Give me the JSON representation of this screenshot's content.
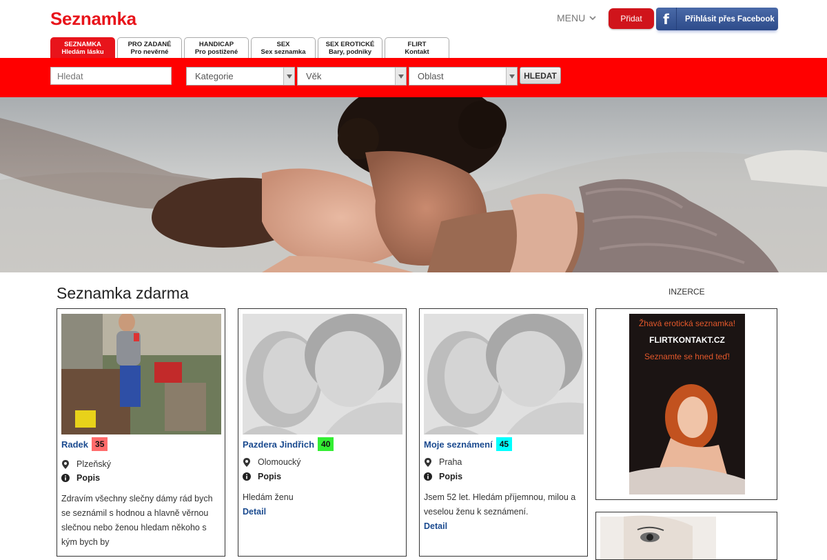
{
  "header": {
    "logo": "Seznamka",
    "menu_label": "MENU",
    "add_label": "Přidat",
    "facebook_label": "Přihlásit přes Facebook"
  },
  "tabs": [
    {
      "title": "SEZNAMKA",
      "sub": "Hledám lásku",
      "active": true
    },
    {
      "title": "PRO ZADANÉ",
      "sub": "Pro nevěrné",
      "active": false
    },
    {
      "title": "HANDICAP",
      "sub": "Pro postižené",
      "active": false
    },
    {
      "title": "SEX",
      "sub": "Sex seznamka",
      "active": false
    },
    {
      "title": "SEX EROTICKÉ",
      "sub": "Bary, podniky",
      "active": false
    },
    {
      "title": "FLIRT",
      "sub": "Kontakt",
      "active": false
    }
  ],
  "search": {
    "placeholder": "Hledat",
    "category": "Kategorie",
    "age": "Věk",
    "region": "Oblast",
    "button": "HLEDAT"
  },
  "content": {
    "title": "Seznamka zdarma",
    "ads_label": "INZERCE"
  },
  "cards": [
    {
      "name": "Radek",
      "age": "35",
      "age_color": "#ff6b6b",
      "location": "Plzeňský",
      "popis_label": "Popis",
      "description": "Zdravím všechny slečny dámy rád bych se seznámil s hodnou a hlavně věrnou slečnou nebo ženou hledam někoho s kým bych by",
      "detail": ""
    },
    {
      "name": "Pazdera Jindřich",
      "age": "40",
      "age_color": "#33ee33",
      "location": "Olomoucký",
      "popis_label": "Popis",
      "description": "Hledám ženu",
      "detail": "Detail"
    },
    {
      "name": "Moje seznámení",
      "age": "45",
      "age_color": "#00ffff",
      "location": "Praha",
      "popis_label": "Popis",
      "description": "Jsem 52  let. Hledám příjemnou, milou a veselou ženu k seznámení.",
      "detail": "Detail"
    }
  ],
  "ad": {
    "line1": "Žhavá erotická seznamka!",
    "line2": "FLIRTKONTAKT.CZ",
    "line3": "Seznamte se hned teď!"
  },
  "colors": {
    "brand_red": "#e8141b",
    "link_blue": "#1a4a8f"
  }
}
